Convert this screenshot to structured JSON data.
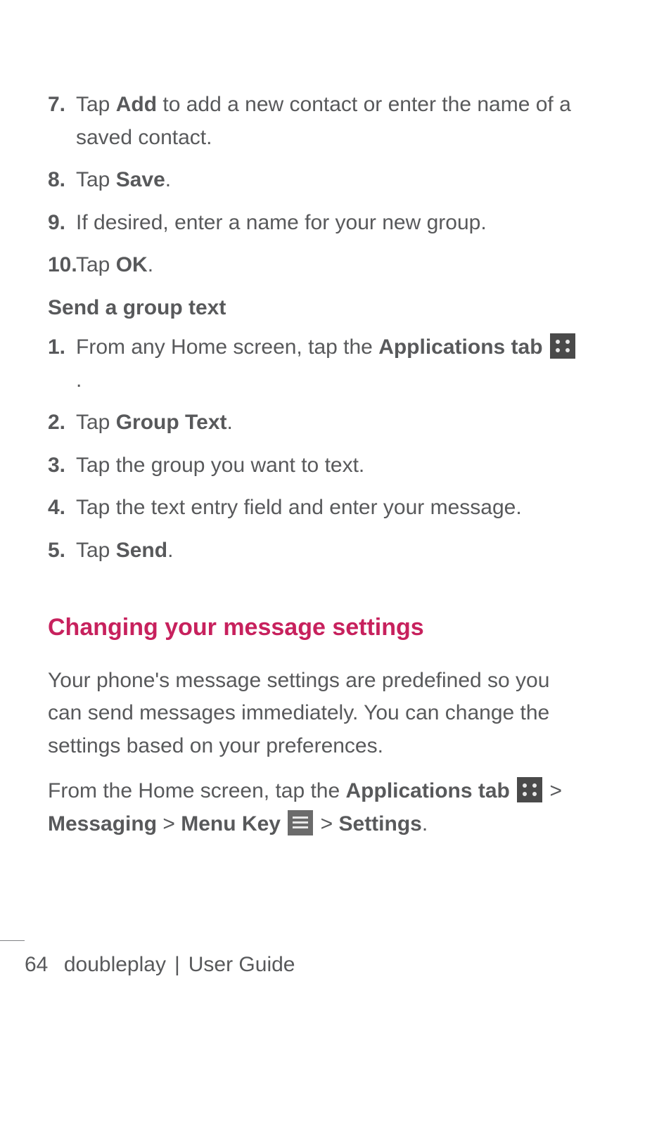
{
  "listA": {
    "items": [
      {
        "num": "7.",
        "pre": "Tap ",
        "bold": "Add",
        "post": " to add a new contact or enter the name of a saved contact."
      },
      {
        "num": "8.",
        "pre": "Tap ",
        "bold": "Save",
        "post": "."
      },
      {
        "num": "9.",
        "pre": "If desired, enter a name for your new group.",
        "bold": "",
        "post": ""
      },
      {
        "num": "10.",
        "pre": "Tap ",
        "bold": "OK",
        "post": "."
      }
    ]
  },
  "subhead1": "Send a group text",
  "listB": {
    "items": [
      {
        "num": "1.",
        "pre": "From any Home screen, tap the ",
        "bold": "Applications tab",
        "post": " ",
        "icon": "apps",
        "tail": "."
      },
      {
        "num": "2.",
        "pre": "Tap ",
        "bold": "Group Text",
        "post": "."
      },
      {
        "num": "3.",
        "pre": "Tap the group you want to text.",
        "bold": "",
        "post": ""
      },
      {
        "num": "4.",
        "pre": "Tap the text entry field and enter your message.",
        "bold": "",
        "post": ""
      },
      {
        "num": "5.",
        "pre": "Tap ",
        "bold": "Send",
        "post": "."
      }
    ]
  },
  "section_title": "Changing your message settings",
  "para1": "Your phone's message settings are predefined so you can send messages immediately. You can change the settings based on your preferences.",
  "nav": {
    "pre": "From the Home screen, tap the ",
    "b1": "Applications tab",
    "sep": " > ",
    "b2": "Messaging",
    "b3": "Menu Key",
    "b4": "Settings",
    "tail": "."
  },
  "footer": {
    "page_number": "64",
    "doc_title": "doubleplay",
    "separator": "|",
    "doc_subtitle": "User Guide"
  }
}
